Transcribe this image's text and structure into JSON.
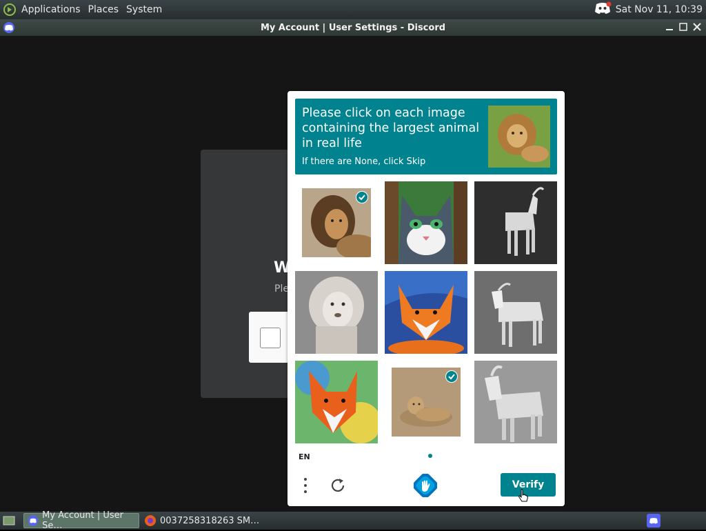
{
  "top_panel": {
    "menus": [
      "Applications",
      "Places",
      "System"
    ],
    "clock": "Sat Nov 11, 10:39"
  },
  "window": {
    "title": "My Account | User Settings - Discord"
  },
  "background_modal": {
    "heading": "W",
    "subtext": "Ple"
  },
  "captcha": {
    "prompt": "Please click on each image containing the largest animal in real life",
    "hint": "If there are None, click Skip",
    "language": "EN",
    "verify_label": "Verify",
    "tiles": [
      {
        "subject": "lion",
        "selected": true
      },
      {
        "subject": "cat-painting",
        "selected": false
      },
      {
        "subject": "goat-figure",
        "selected": false
      },
      {
        "subject": "white-lion",
        "selected": false
      },
      {
        "subject": "fox-painting",
        "selected": false
      },
      {
        "subject": "goat-figure",
        "selected": false
      },
      {
        "subject": "fox-painting",
        "selected": false
      },
      {
        "subject": "lioness",
        "selected": true
      },
      {
        "subject": "goat-figure",
        "selected": false
      }
    ],
    "accent_color": "#00838f"
  },
  "taskbar": {
    "tasks": [
      {
        "label": "My Account | User Se…",
        "active": true,
        "icon": "discord-icon"
      },
      {
        "label": "0037258318263 SM…",
        "active": false,
        "icon": "firefox-icon"
      }
    ]
  }
}
